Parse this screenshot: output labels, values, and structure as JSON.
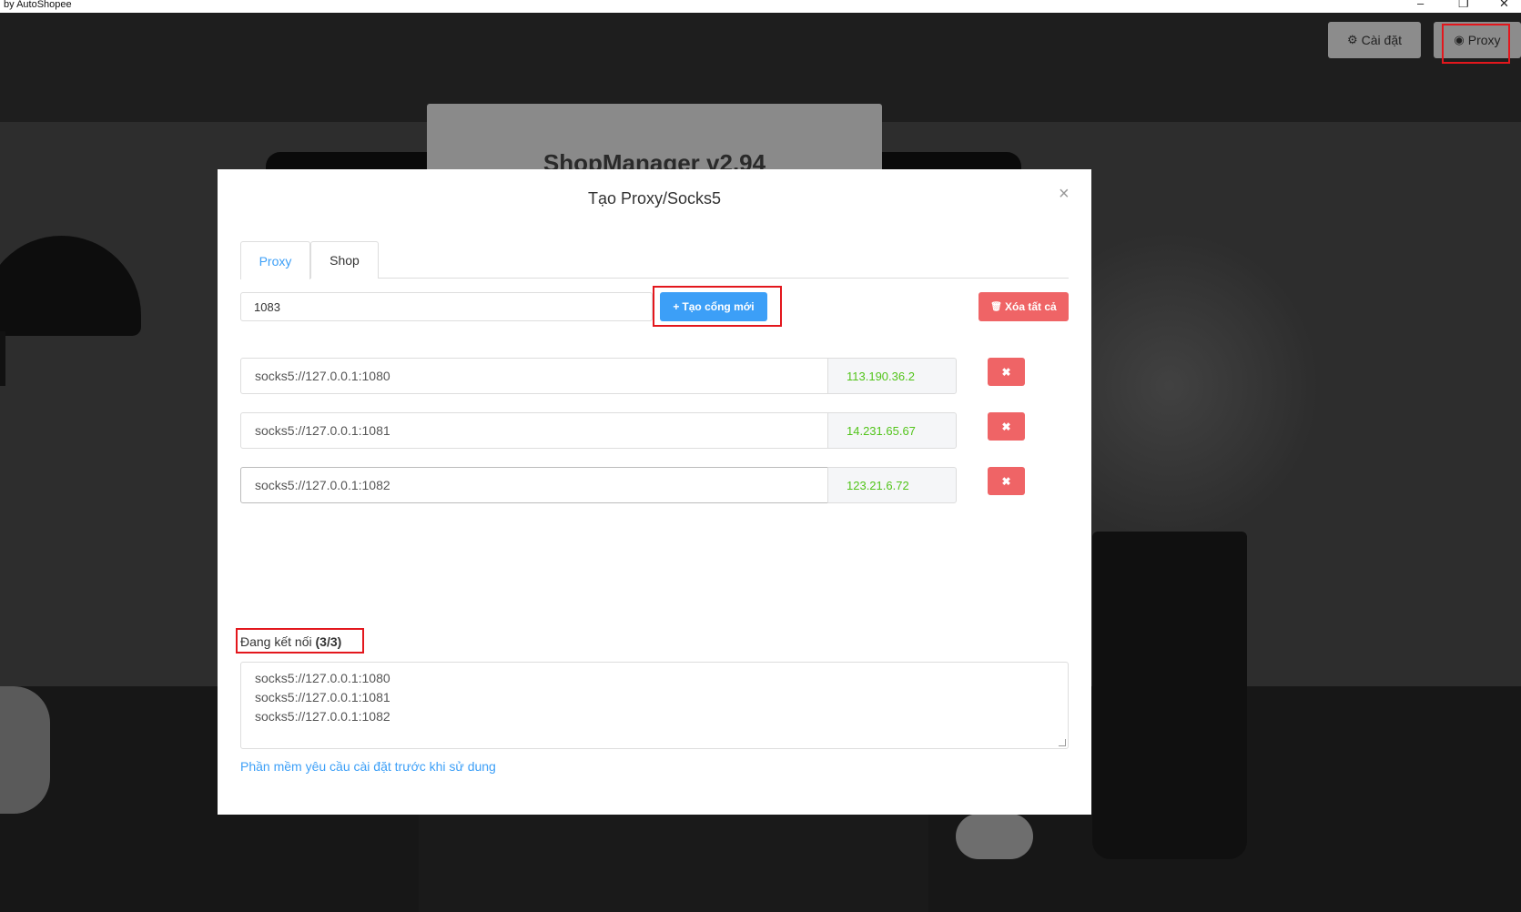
{
  "window": {
    "title": "by AutoShopee",
    "controls": {
      "minimize": "–",
      "restore": "❐",
      "close": "✕"
    }
  },
  "background": {
    "app_heading": "ShopManager v2.94"
  },
  "top_buttons": {
    "settings": {
      "icon": "gear-icon",
      "glyph": "⚙",
      "label": "Cài đặt"
    },
    "proxy": {
      "icon": "globe-icon",
      "glyph": "◉",
      "label": "Proxy"
    }
  },
  "modal": {
    "title": "Tạo Proxy/Socks5",
    "close_glyph": "×",
    "tabs": [
      {
        "label": "Proxy",
        "active": true
      },
      {
        "label": "Shop",
        "active": false
      }
    ],
    "port_value": "1083",
    "create_button": {
      "glyph": "+",
      "label": "Tạo cổng mới"
    },
    "clear_button": {
      "glyph": "🗑",
      "label": "Xóa tất cả"
    },
    "proxies": [
      {
        "address": "socks5://127.0.0.1:1080",
        "ip": "113.190.36.2",
        "delete_glyph": "✖"
      },
      {
        "address": "socks5://127.0.0.1:1081",
        "ip": "14.231.65.67",
        "delete_glyph": "✖"
      },
      {
        "address": "socks5://127.0.0.1:1082",
        "ip": "123.21.6.72",
        "delete_glyph": "✖"
      }
    ],
    "connection": {
      "label": "Đang kết nối",
      "count": "(3/3)",
      "lines": [
        "socks5://127.0.0.1:1080",
        "socks5://127.0.0.1:1081",
        "socks5://127.0.0.1:1082"
      ]
    },
    "note_link": "Phần mềm yêu cầu cài đặt trước khi sử dung"
  },
  "colors": {
    "primary": "#3c9ff7",
    "danger": "#ef6466",
    "success_text": "#52c41a",
    "highlight_box": "#e3171d"
  }
}
